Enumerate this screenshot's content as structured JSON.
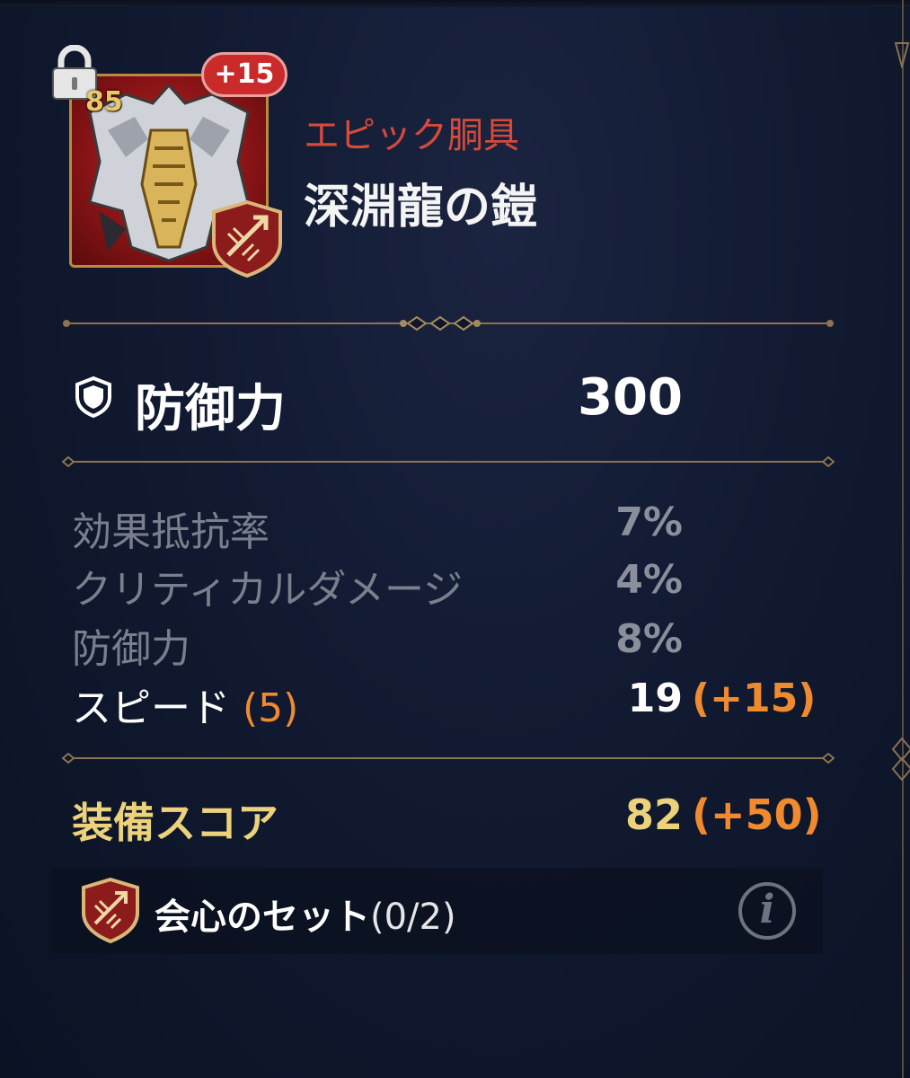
{
  "item": {
    "level": "85",
    "enhance": "+15",
    "rarity_label": "エピック胴具",
    "name": "深淵龍の鎧",
    "locked": true
  },
  "main_stat": {
    "label": "防御力",
    "value": "300",
    "icon": "shield-icon"
  },
  "sub_stats": [
    {
      "label": "効果抵抗率",
      "value": "7%",
      "active": false
    },
    {
      "label": "クリティカルダメージ",
      "value": "4%",
      "active": false
    },
    {
      "label": "防御力",
      "value": "8%",
      "active": false
    },
    {
      "label": "スピード",
      "label_extra": "(5)",
      "value": "19",
      "bonus": "(+15)",
      "active": true
    }
  ],
  "gear_score": {
    "label": "装備スコア",
    "value": "82",
    "bonus": "(+50)"
  },
  "set": {
    "label": "会心のセット",
    "count": "(0/2)",
    "icon": "critical-set-emblem-icon",
    "info_icon": "info-icon"
  },
  "colors": {
    "rarity_epic": "#d64a3c",
    "accent_orange": "#f08a2e",
    "score_gold": "#ecd27a",
    "frame_gold": "#b98a3f"
  }
}
